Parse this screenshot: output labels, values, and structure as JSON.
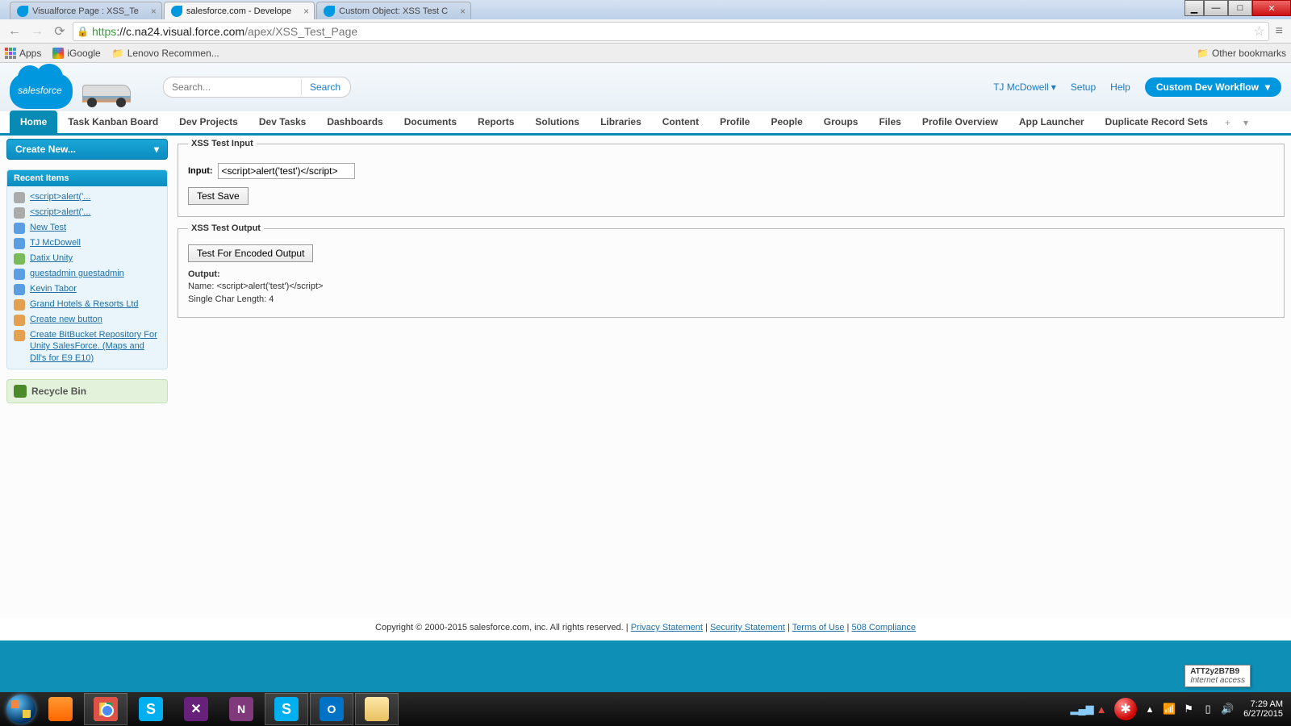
{
  "browser": {
    "tabs": [
      {
        "title": "Visualforce Page : XSS_Te",
        "active": false
      },
      {
        "title": "salesforce.com - Develope",
        "active": true
      },
      {
        "title": "Custom Object: XSS Test C",
        "active": false
      }
    ],
    "url_proto": "https",
    "url_domain": "://c.na24.visual.force.com",
    "url_path": "/apex/XSS_Test_Page",
    "bookmarks": {
      "apps": "Apps",
      "igoogle": "iGoogle",
      "lenovo": "Lenovo Recommen...",
      "other": "Other bookmarks"
    }
  },
  "header": {
    "logo_text": "salesforce",
    "search_placeholder": "Search...",
    "search_btn": "Search",
    "user": "TJ McDowell",
    "setup": "Setup",
    "help": "Help",
    "workflow": "Custom Dev Workflow"
  },
  "tabs": [
    "Home",
    "Task Kanban Board",
    "Dev Projects",
    "Dev Tasks",
    "Dashboards",
    "Documents",
    "Reports",
    "Solutions",
    "Libraries",
    "Content",
    "Profile",
    "People",
    "Groups",
    "Files",
    "Profile Overview",
    "App Launcher",
    "Duplicate Record Sets"
  ],
  "sidebar": {
    "create": "Create New...",
    "recent_header": "Recent Items",
    "items": [
      {
        "icon": "gray",
        "label": "<script>alert('..."
      },
      {
        "icon": "gray",
        "label": "<script>alert('..."
      },
      {
        "icon": "blue",
        "label": "New Test"
      },
      {
        "icon": "blue",
        "label": "TJ McDowell"
      },
      {
        "icon": "green",
        "label": "Datix Unity"
      },
      {
        "icon": "blue",
        "label": "guestadmin guestadmin"
      },
      {
        "icon": "blue",
        "label": "Kevin Tabor"
      },
      {
        "icon": "orange",
        "label": "Grand Hotels & Resorts Ltd"
      },
      {
        "icon": "orange",
        "label": "Create new button"
      },
      {
        "icon": "orange",
        "label": "Create BitBucket Repository For Unity SalesForce. (Maps and Dll's for E9 E10)"
      }
    ],
    "recycle": "Recycle Bin"
  },
  "xss_input": {
    "legend": "XSS Test Input",
    "label": "Input:",
    "value": "<script>alert('test')</script>",
    "save_btn": "Test Save"
  },
  "xss_output": {
    "legend": "XSS Test Output",
    "test_btn": "Test For Encoded Output",
    "output_label": "Output:",
    "name_line": "Name: <script>alert('test')</script>",
    "len_line": "Single Char Length: 4"
  },
  "footer": {
    "copyright": "Copyright © 2000-2015 salesforce.com, inc. All rights reserved.",
    "privacy": "Privacy Statement",
    "security": "Security Statement",
    "terms": "Terms of Use",
    "compliance": "508 Compliance"
  },
  "tooltip": {
    "line1": "ATT2y2B7B9",
    "line2": "Internet access"
  },
  "clock": {
    "time": "7:29 AM",
    "date": "6/27/2015"
  }
}
